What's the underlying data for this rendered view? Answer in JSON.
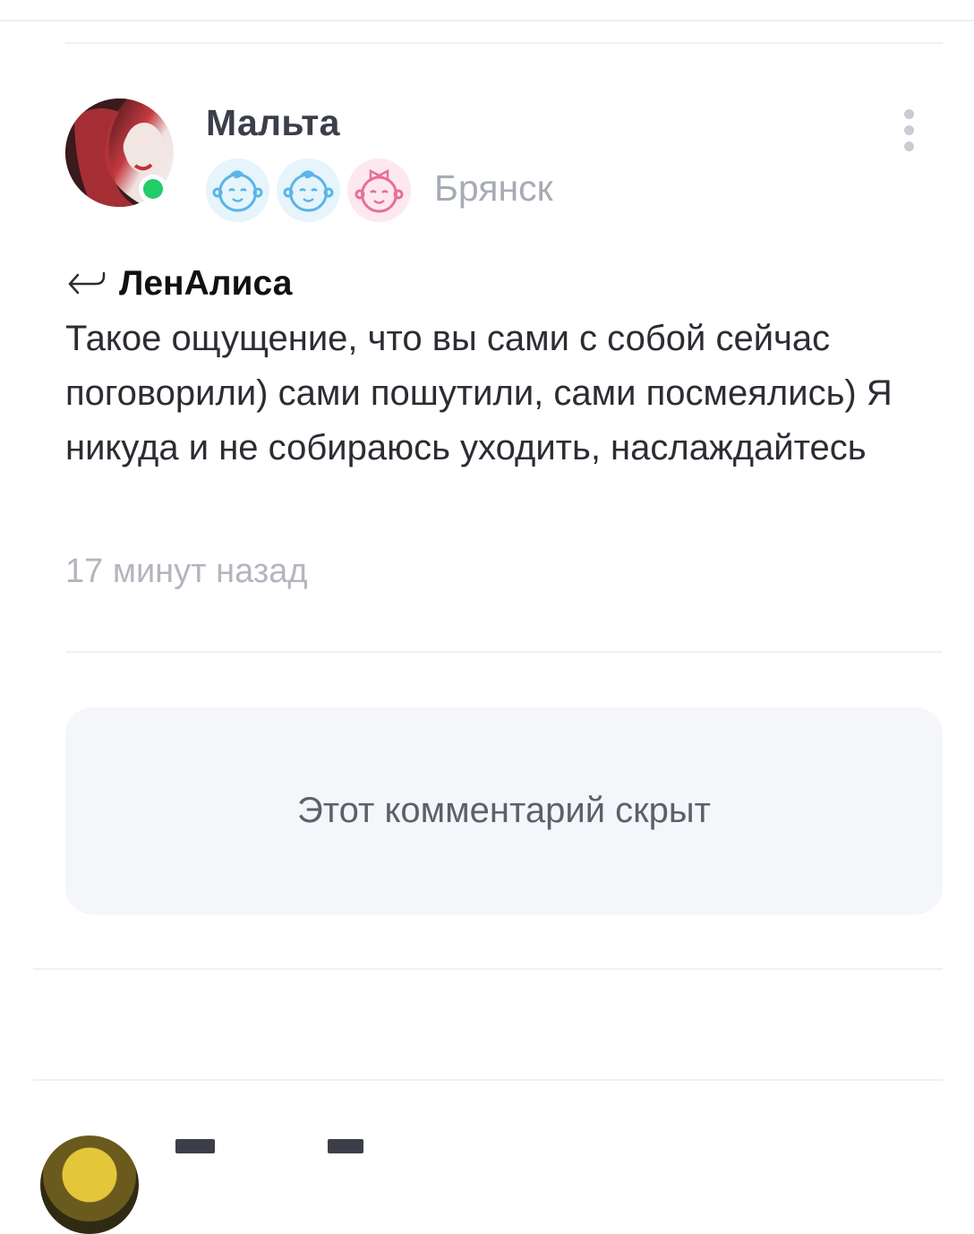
{
  "comment": {
    "author": "Мальта",
    "city": "Брянск",
    "online": true,
    "children_badges": [
      {
        "icon": "baby-boy-icon",
        "color": "#5ab5e8"
      },
      {
        "icon": "baby-boy-icon",
        "color": "#5ab5e8"
      },
      {
        "icon": "baby-girl-icon",
        "color": "#e86f9a"
      }
    ],
    "reply_to": "ЛенАлиса",
    "text": "Такое ощущение, что вы сами с собой сейчас поговорили) сами пошутили, сами посмеялись) Я никуда и не собираюсь уходить, наслаждайтесь",
    "time": "17 минут назад"
  },
  "hidden_comment": {
    "label": "Этот комментарий скрыт"
  },
  "colors": {
    "online": "#22cc66",
    "author": "#3c3e4a",
    "muted": "#a7abb6",
    "hidden_bg": "#f4f6fa"
  }
}
